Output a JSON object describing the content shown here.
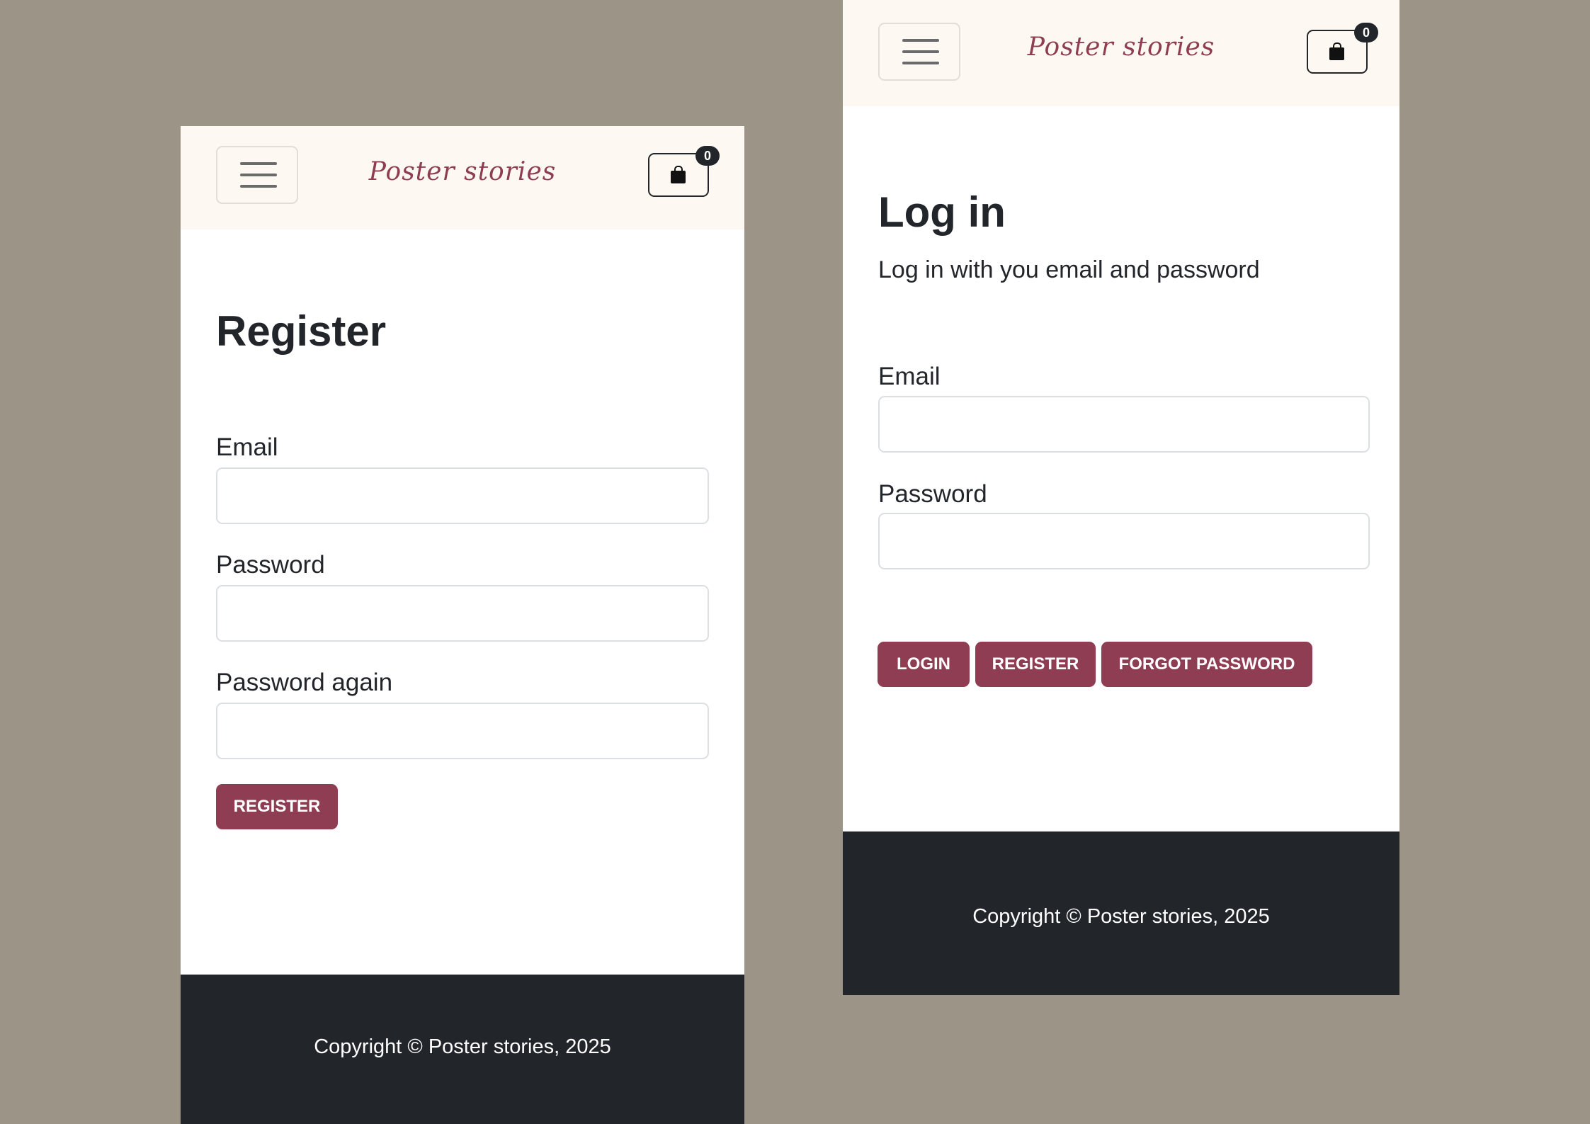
{
  "colors": {
    "background": "#9c9587",
    "navbar": "#fdf9f2",
    "brand": "#8e3d53",
    "button": "#8e3d53",
    "footer": "#22252a"
  },
  "register_screen": {
    "navbar": {
      "menu_icon": "hamburger-icon",
      "brand": "Poster stories",
      "cart_icon": "shopping-bag-icon",
      "cart_count": "0"
    },
    "title": "Register",
    "fields": [
      {
        "label": "Email",
        "value": "",
        "placeholder": ""
      },
      {
        "label": "Password",
        "value": "",
        "placeholder": ""
      },
      {
        "label": "Password again",
        "value": "",
        "placeholder": ""
      }
    ],
    "register_button": "Register",
    "footer": "Copyright © Poster stories, 2025"
  },
  "login_screen": {
    "navbar": {
      "menu_icon": "hamburger-icon",
      "brand": "Poster stories",
      "cart_icon": "shopping-bag-icon",
      "cart_count": "0"
    },
    "title": "Log in",
    "subtitle": "Log in with you email and password",
    "fields": [
      {
        "label": "Email",
        "value": "",
        "placeholder": ""
      },
      {
        "label": "Password",
        "value": "",
        "placeholder": ""
      }
    ],
    "buttons": {
      "login": "Login",
      "register": "Register",
      "forgot_password": "Forgot password"
    },
    "footer": "Copyright © Poster stories, 2025"
  }
}
